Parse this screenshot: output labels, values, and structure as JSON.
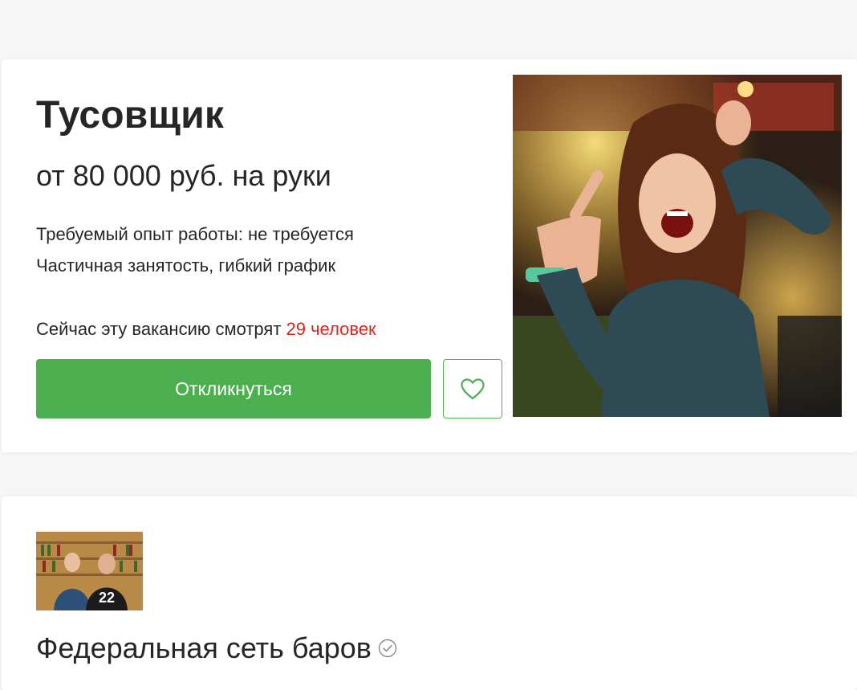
{
  "vacancy": {
    "title": "Тусовщик",
    "salary": "от 80 000 руб. на руки",
    "experience": "Требуемый опыт работы: не требуется",
    "schedule": "Частичная занятость, гибкий график",
    "viewing_prefix": "Сейчас эту вакансию смотрят ",
    "viewing_count": "29 человек",
    "apply_label": "Откликнуться",
    "favorite_icon": "heart-icon"
  },
  "employer": {
    "name": "Федеральная сеть баров",
    "verified_icon": "check-circle-icon"
  },
  "colors": {
    "accent": "#4caf50",
    "highlight": "#d6291b",
    "text": "#262626"
  }
}
